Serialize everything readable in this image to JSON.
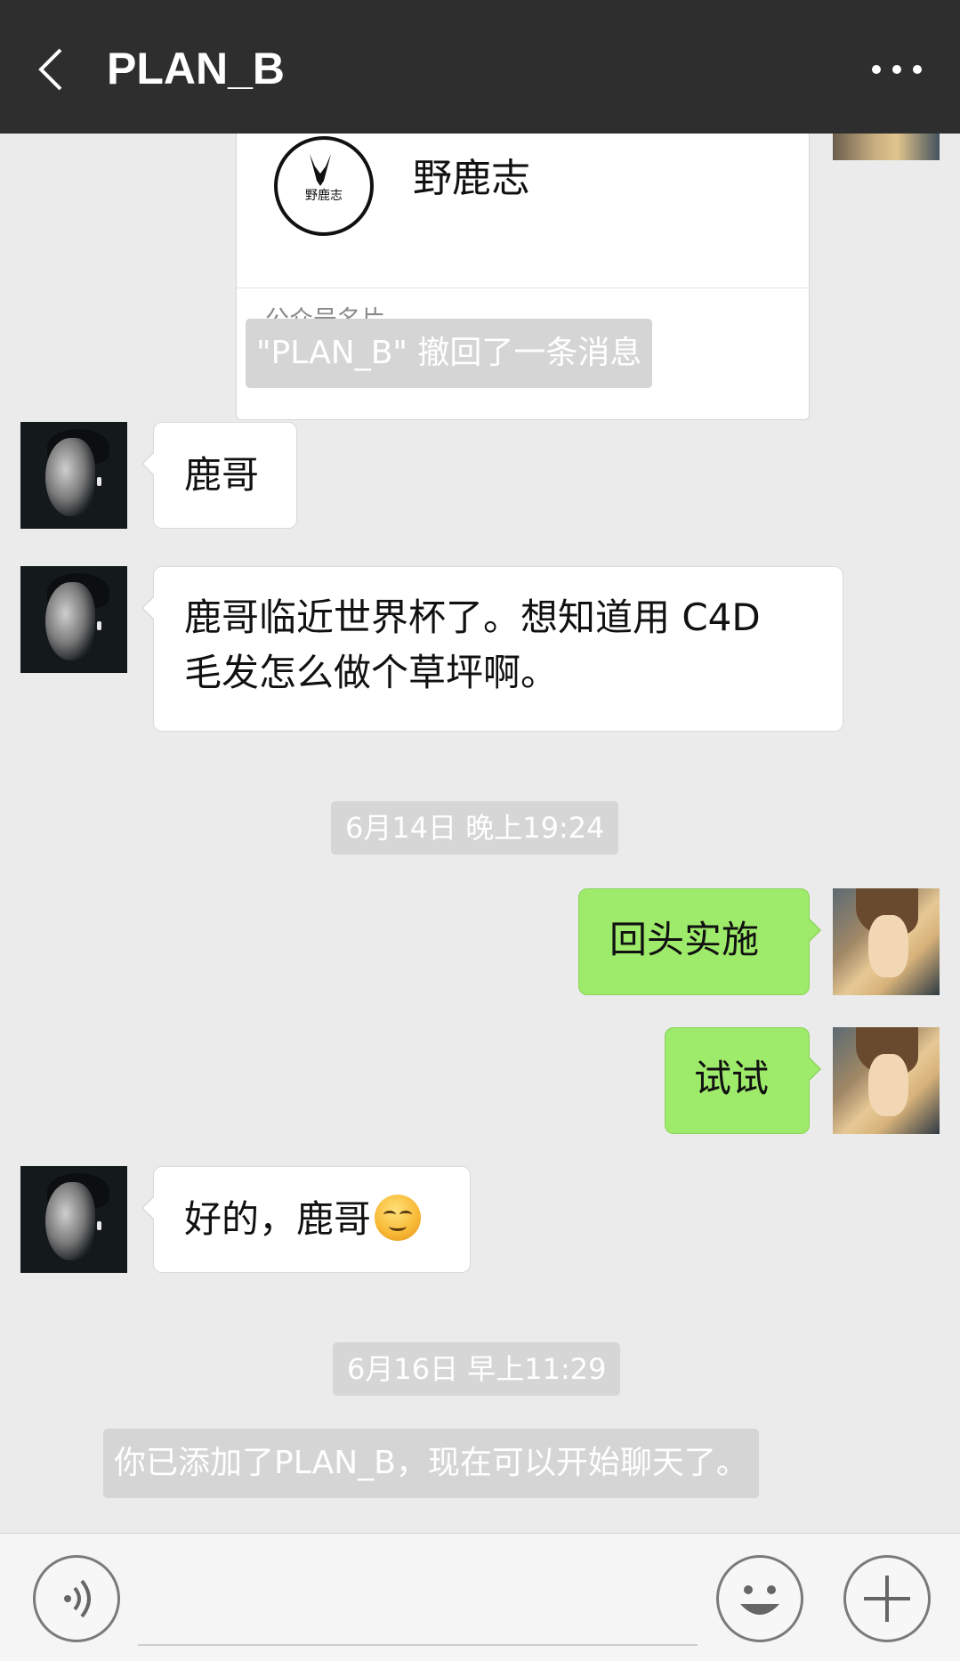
{
  "header": {
    "title": "PLAN_B",
    "back_icon": "chevron-left-icon",
    "more_icon": "more-dots-icon"
  },
  "card": {
    "logo_text": "野鹿志",
    "name": "野鹿志",
    "footer": "公众号名片"
  },
  "notices": {
    "recall": "\"PLAN_B\" 撤回了一条消息",
    "added": "你已添加了PLAN_B，现在可以开始聊天了。"
  },
  "timestamps": {
    "first": "6月14日 晚上19:24",
    "second": "6月16日 早上11:29"
  },
  "messages": [
    {
      "side": "in",
      "text": "鹿哥"
    },
    {
      "side": "in",
      "line1": "鹿哥临近世界杯了。想知道用 C4D",
      "line2": "毛发怎么做个草坪啊。"
    },
    {
      "side": "out",
      "text": "回头实施"
    },
    {
      "side": "out",
      "text": "试试"
    },
    {
      "side": "in",
      "text": "好的，鹿哥",
      "emoji": "smirk-emoji"
    }
  ],
  "input": {
    "voice_icon": "voice-icon",
    "emoji_icon": "emoji-icon",
    "plus_icon": "plus-icon"
  },
  "colors": {
    "header_bg": "#2e2e2e",
    "chat_bg": "#ebebeb",
    "out_bubble": "#9eea6a",
    "in_bubble": "#ffffff"
  }
}
